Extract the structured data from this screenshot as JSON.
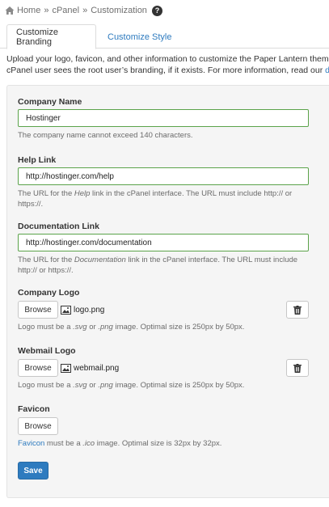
{
  "breadcrumb": {
    "home": "Home",
    "separator": "»",
    "cpanel": "cPanel",
    "current": "Customization",
    "help_icon": "?"
  },
  "tabs": [
    {
      "label": "Customize Branding",
      "active": true
    },
    {
      "label": "Customize Style",
      "active": false
    }
  ],
  "intro": {
    "line1": "Upload your logo, favicon, and other information to customize the Paper Lantern theme for",
    "line2_text": "cPanel user sees the root user’s branding, if it exists. For more information, read our ",
    "line2_link": "docum"
  },
  "form": {
    "company_name": {
      "label": "Company Name",
      "value": "Hostinger",
      "hint": "The company name cannot exceed 140 characters."
    },
    "help_link": {
      "label": "Help Link",
      "value": "http://hostinger.com/help",
      "hint_pre": "The URL for the ",
      "hint_em": "Help",
      "hint_post": " link in the cPanel interface. The URL must include http:// or https://."
    },
    "documentation_link": {
      "label": "Documentation Link",
      "value": "http://hostinger.com/documentation",
      "hint_pre": "The URL for the ",
      "hint_em": "Documentation",
      "hint_post": " link in the cPanel interface. The URL must include http:// or https://."
    },
    "company_logo": {
      "label": "Company Logo",
      "browse": "Browse",
      "filename": "logo.png",
      "hint_pre": "Logo must be a ",
      "hint_em1": ".svg",
      "hint_mid": " or ",
      "hint_em2": ".png",
      "hint_post": " image. Optimal size is 250px by 50px."
    },
    "webmail_logo": {
      "label": "Webmail Logo",
      "browse": "Browse",
      "filename": "webmail.png",
      "hint_pre": "Logo must be a ",
      "hint_em1": ".svg",
      "hint_mid": " or ",
      "hint_em2": ".png",
      "hint_post": " image. Optimal size is 250px by 50px."
    },
    "favicon": {
      "label": "Favicon",
      "browse": "Browse",
      "hint_link": "Favicon",
      "hint_pre": " must be a ",
      "hint_em": ".ico",
      "hint_post": " image. Optimal size is 32px by 32px."
    },
    "save_label": "Save"
  },
  "colors": {
    "accent": "#2e7bbf",
    "valid_border": "#5ba34a",
    "panel_bg": "#f5f5f5"
  },
  "icons": {
    "home": "home-icon",
    "help": "help-icon",
    "image": "image-icon",
    "delete": "trash-icon"
  }
}
